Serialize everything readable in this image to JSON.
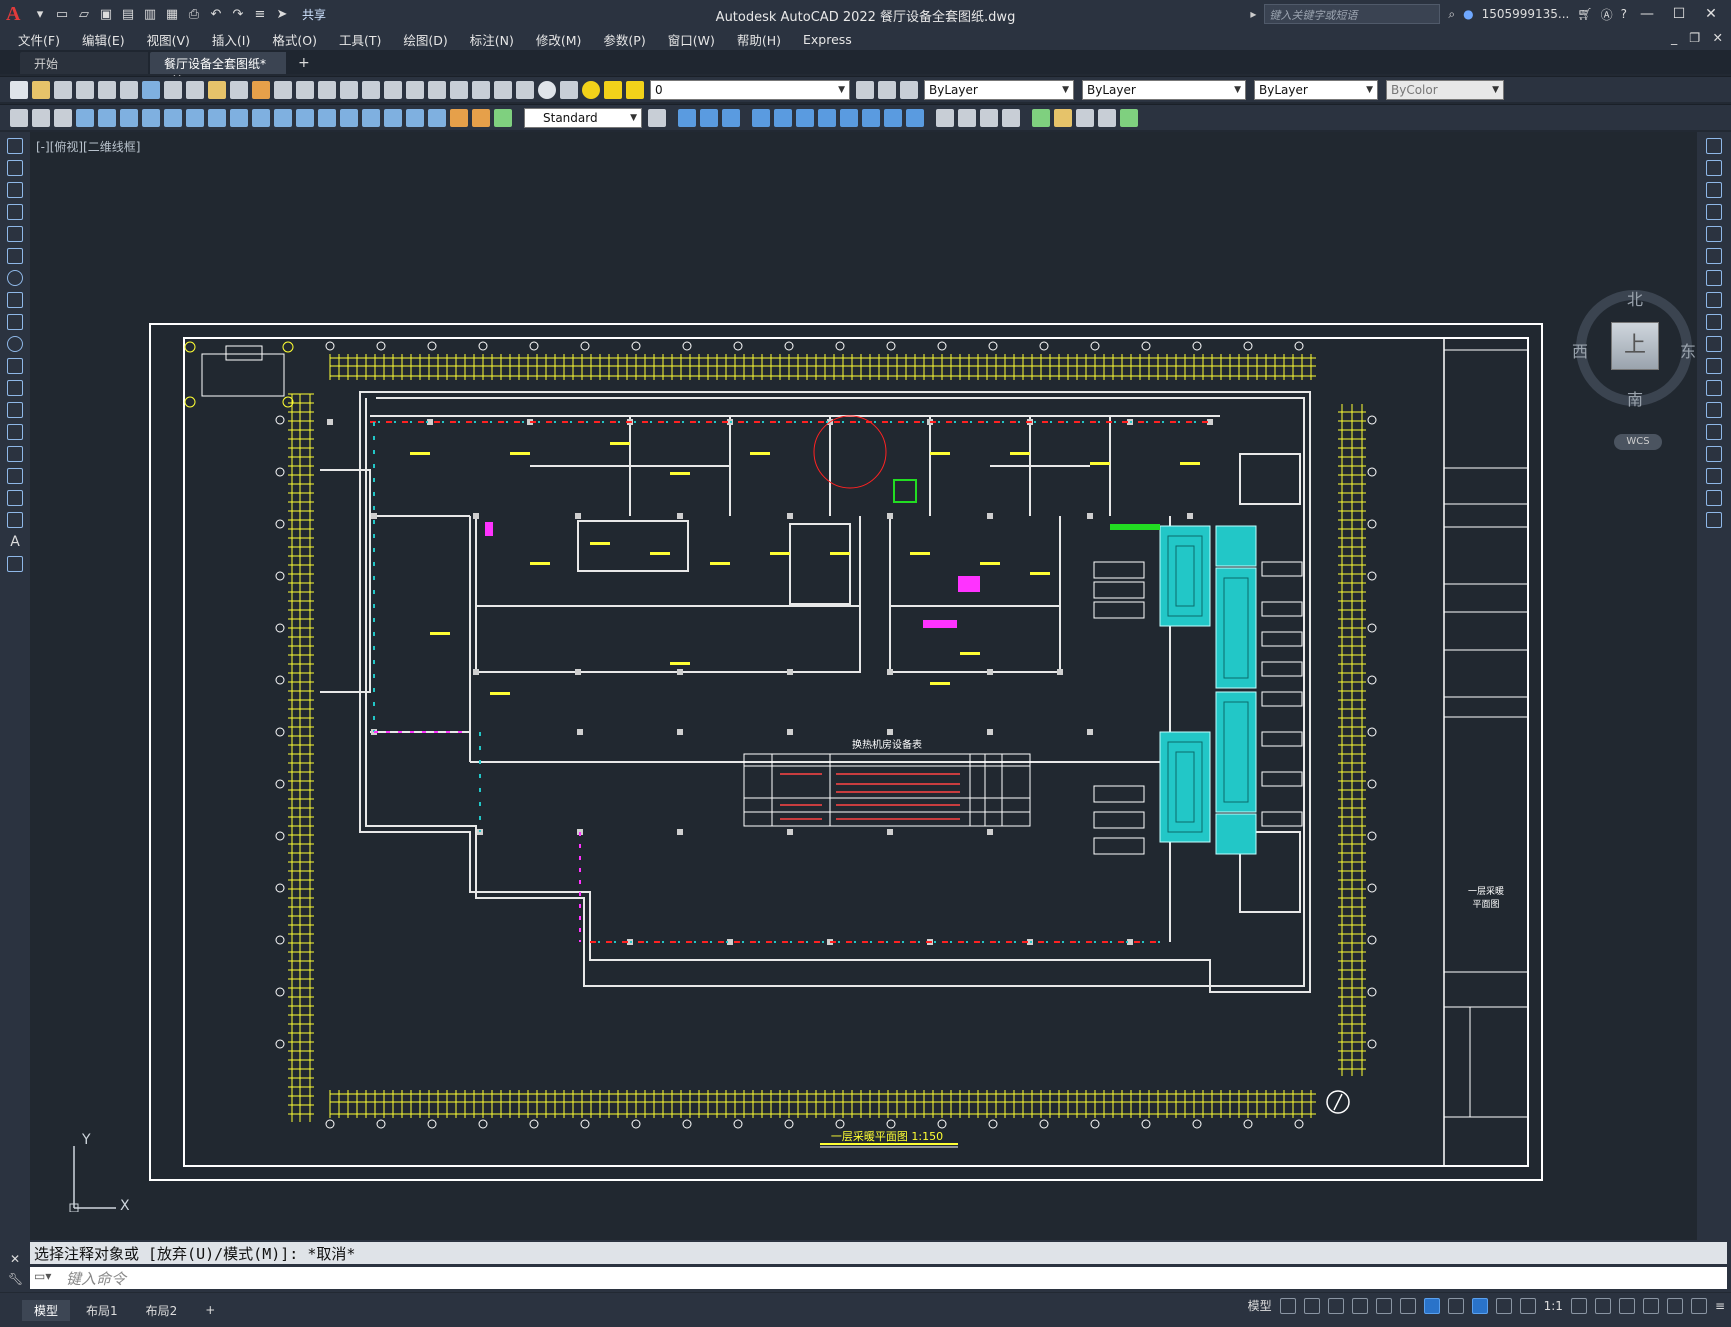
{
  "window": {
    "title": "Autodesk AutoCAD 2022    餐厅设备全套图纸.dwg",
    "share_label": "共享",
    "search_placeholder": "键入关键字或短语",
    "user": "1505999135...",
    "app_logo": "A"
  },
  "menu": {
    "items": [
      "文件(F)",
      "编辑(E)",
      "视图(V)",
      "插入(I)",
      "格式(O)",
      "工具(T)",
      "绘图(D)",
      "标注(N)",
      "修改(M)",
      "参数(P)",
      "窗口(W)",
      "帮助(H)",
      "Express"
    ]
  },
  "tabs": {
    "start": "开始",
    "drawing": "餐厅设备全套图纸*",
    "add": "+"
  },
  "toolbar": {
    "layer_value": "0",
    "color": "ByLayer",
    "linetype": "ByLayer",
    "lineweight": "ByLayer",
    "plotstyle": "ByColor",
    "textstyle": "Standard"
  },
  "viewport": {
    "label": "[-][俯视][二维线框]",
    "compass": {
      "north": "北",
      "south": "南",
      "east": "东",
      "west": "西",
      "top": "上"
    },
    "wcs": "WCS",
    "ucs_x": "X",
    "ucs_y": "Y"
  },
  "drawing": {
    "plan_title": "一层采暖平面图 1:150",
    "table_title": "换热机房设备表",
    "sheet_name": "一层采暖\n平面图"
  },
  "command": {
    "history": "选择注释对象或 [放弃(U)/模式(M)]: *取消*",
    "placeholder": "键入命令"
  },
  "status": {
    "layout_tabs": [
      "模型",
      "布局1",
      "布局2"
    ],
    "add": "+",
    "model": "模型",
    "scale": "1:1"
  },
  "colors": {
    "background": "#212830",
    "frame": "#ffffff",
    "wall": "#e8e8e8",
    "dim": "#ffff33",
    "heating": "#22c7c7",
    "pink": "#ff33ff",
    "red": "#ff2222",
    "green": "#22dd22"
  }
}
